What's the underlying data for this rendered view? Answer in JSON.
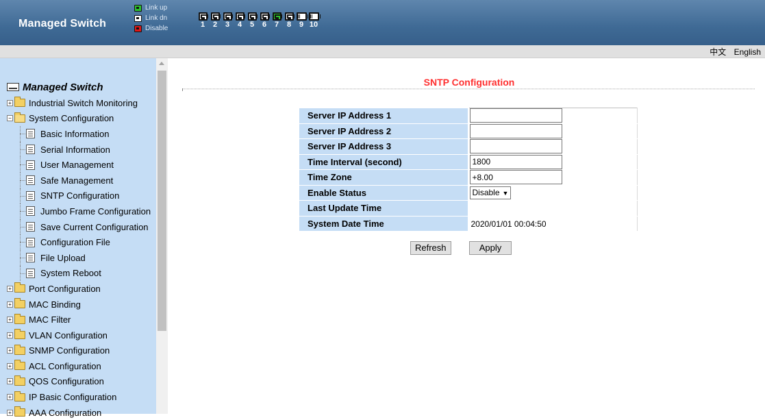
{
  "header": {
    "brand": "Managed Switch",
    "legend": [
      {
        "label": "Link up",
        "state": "up"
      },
      {
        "label": "Link dn",
        "state": "dn"
      },
      {
        "label": "Disable",
        "state": "dis"
      }
    ],
    "ports": [
      {
        "num": "1",
        "type": "copper",
        "active": false
      },
      {
        "num": "2",
        "type": "copper",
        "active": false
      },
      {
        "num": "3",
        "type": "copper",
        "active": false
      },
      {
        "num": "4",
        "type": "copper",
        "active": false
      },
      {
        "num": "5",
        "type": "copper",
        "active": false
      },
      {
        "num": "6",
        "type": "copper",
        "active": false
      },
      {
        "num": "7",
        "type": "copper",
        "active": true
      },
      {
        "num": "8",
        "type": "copper",
        "active": false
      },
      {
        "num": "9",
        "type": "fiber",
        "active": false
      },
      {
        "num": "10",
        "type": "fiber",
        "active": false
      }
    ]
  },
  "lang": {
    "chinese": "中文",
    "english": "English"
  },
  "sidebar": {
    "root": "Managed Switch",
    "items": [
      {
        "label": "Industrial Switch Monitoring",
        "kind": "folder",
        "expanded": false
      },
      {
        "label": "System Configuration",
        "kind": "folder",
        "expanded": true
      },
      {
        "label": "Basic Information",
        "kind": "doc"
      },
      {
        "label": "Serial Information",
        "kind": "doc"
      },
      {
        "label": "User Management",
        "kind": "doc"
      },
      {
        "label": "Safe Management",
        "kind": "doc"
      },
      {
        "label": "SNTP Configuration",
        "kind": "doc"
      },
      {
        "label": "Jumbo Frame Configuration",
        "kind": "doc"
      },
      {
        "label": "Save Current Configuration",
        "kind": "doc"
      },
      {
        "label": "Configuration File",
        "kind": "doc"
      },
      {
        "label": "File Upload",
        "kind": "doc"
      },
      {
        "label": "System Reboot",
        "kind": "doc"
      },
      {
        "label": "Port Configuration",
        "kind": "folder",
        "expanded": false
      },
      {
        "label": "MAC Binding",
        "kind": "folder",
        "expanded": false
      },
      {
        "label": "MAC Filter",
        "kind": "folder",
        "expanded": false
      },
      {
        "label": "VLAN Configuration",
        "kind": "folder",
        "expanded": false
      },
      {
        "label": "SNMP Configuration",
        "kind": "folder",
        "expanded": false
      },
      {
        "label": "ACL Configuration",
        "kind": "folder",
        "expanded": false
      },
      {
        "label": "QOS Configuration",
        "kind": "folder",
        "expanded": false
      },
      {
        "label": "IP Basic Configuration",
        "kind": "folder",
        "expanded": false
      },
      {
        "label": "AAA Configuration",
        "kind": "folder",
        "expanded": false
      }
    ]
  },
  "main": {
    "title": "SNTP Configuration",
    "fields": {
      "server1": {
        "label": "Server IP Address 1",
        "value": ""
      },
      "server2": {
        "label": "Server IP Address 2",
        "value": ""
      },
      "server3": {
        "label": "Server IP Address 3",
        "value": ""
      },
      "interval": {
        "label": "Time Interval (second)",
        "value": "1800"
      },
      "timezone": {
        "label": "Time Zone",
        "value": "+8.00"
      },
      "enable": {
        "label": "Enable Status",
        "value": "Disable"
      },
      "last_update": {
        "label": "Last Update Time",
        "value": ""
      },
      "system_date": {
        "label": "System Date Time",
        "value": "2020/01/01 00:04:50"
      }
    },
    "refresh_label": "Refresh",
    "apply_label": "Apply"
  },
  "colors": {
    "header_bg": "#4a739d",
    "sidebar_bg": "#c5ddf5",
    "title_color": "#ff3030",
    "active_port": "#2ec22e",
    "disabled_port": "#e01818"
  }
}
